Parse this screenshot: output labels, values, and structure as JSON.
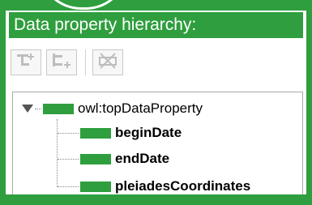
{
  "panel": {
    "title": "Data property hierarchy:"
  },
  "toolbar": {
    "buttons": [
      {
        "icon": "add-subproperty-icon"
      },
      {
        "icon": "add-sibling-property-icon"
      },
      {
        "icon": "delete-property-icon"
      }
    ]
  },
  "tree": {
    "root": {
      "label": "owl:topDataProperty",
      "expanded": true
    },
    "children": [
      {
        "label": "beginDate"
      },
      {
        "label": "endDate"
      },
      {
        "label": "pleiadesCoordinates"
      }
    ]
  },
  "colors": {
    "accent": "#2f9e3e",
    "swatch": "#2f9e3e"
  }
}
